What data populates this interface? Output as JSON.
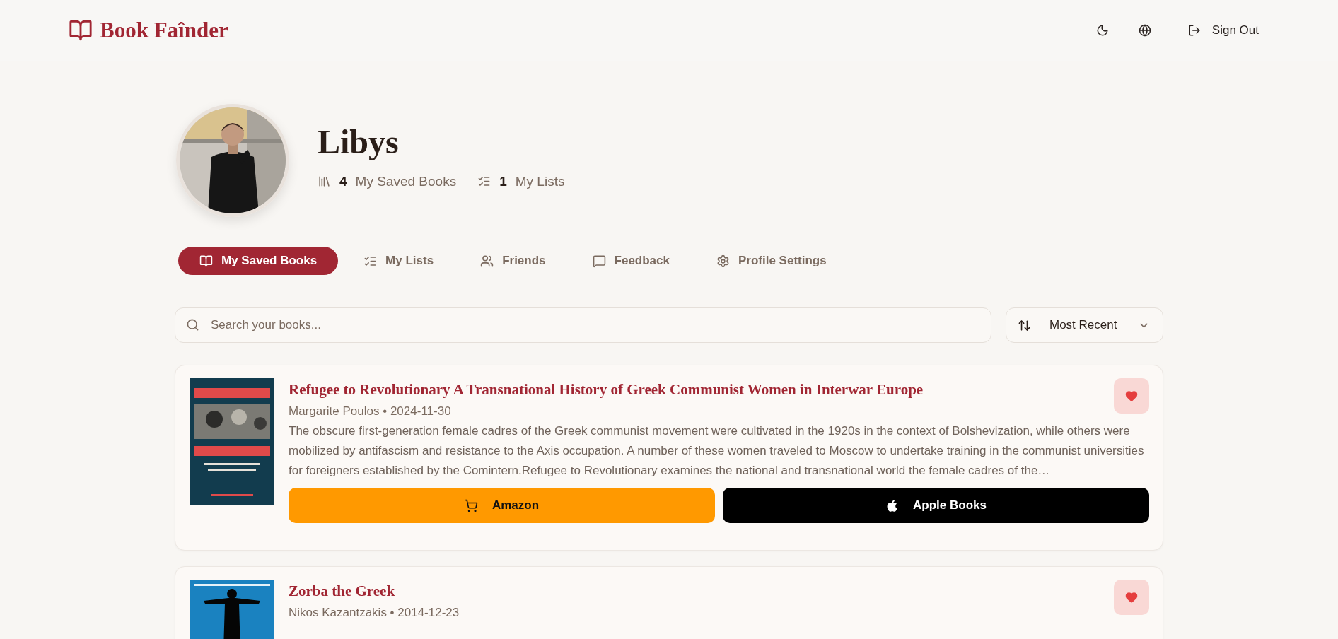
{
  "brand": {
    "name": "Book Faînder"
  },
  "header_actions": [
    {
      "kind": "theme"
    },
    {
      "kind": "language"
    },
    {
      "kind": "signout",
      "label": "Sign Out"
    }
  ],
  "profile": {
    "name": "Libys",
    "avatar": {
      "kind": "picture"
    },
    "stats": [
      {
        "kind": "books",
        "count": "4",
        "label": "My Saved Books"
      },
      {
        "kind": "lists",
        "count": "1",
        "label": "My Lists"
      }
    ]
  },
  "tabs": [
    {
      "kind": "books",
      "label": "My Saved Books",
      "selected": true
    },
    {
      "kind": "lists",
      "label": "My Lists",
      "selected": false
    },
    {
      "kind": "friends",
      "label": "Friends",
      "selected": false
    },
    {
      "kind": "feedback",
      "label": "Feedback",
      "selected": false
    },
    {
      "kind": "settings",
      "label": "Profile Settings",
      "selected": false
    }
  ],
  "search": {
    "placeholder": "Search your books..."
  },
  "sort": {
    "value": "Most Recent"
  },
  "books": [
    {
      "cover": {
        "kind": "picture"
      },
      "title": "Refugee to Revolutionary A Transnational History of Greek Communist Women in Interwar Europe",
      "byline": "Margarite Poulos • 2024-11-30",
      "favorite": true,
      "description": "The obscure first-generation female cadres of the Greek communist movement were cultivated in the 1920s in the context of Bolshevization, while others were mobilized by antifascism and resistance to the Axis occupation. A number of these women traveled to Moscow to undertake training in the communist universities for foreigners established by the Comintern.Refugee to Revolutionary examines the national and transnational world the female cadres of the…",
      "stores": [
        {
          "kind": "amazon",
          "label": "Amazon"
        },
        {
          "kind": "apple",
          "label": "Apple Books"
        }
      ]
    },
    {
      "cover": {
        "kind": "picture"
      },
      "title": "Zorba the Greek",
      "byline": "Nikos Kazantzakis • 2014-12-23",
      "favorite": true
    }
  ]
}
